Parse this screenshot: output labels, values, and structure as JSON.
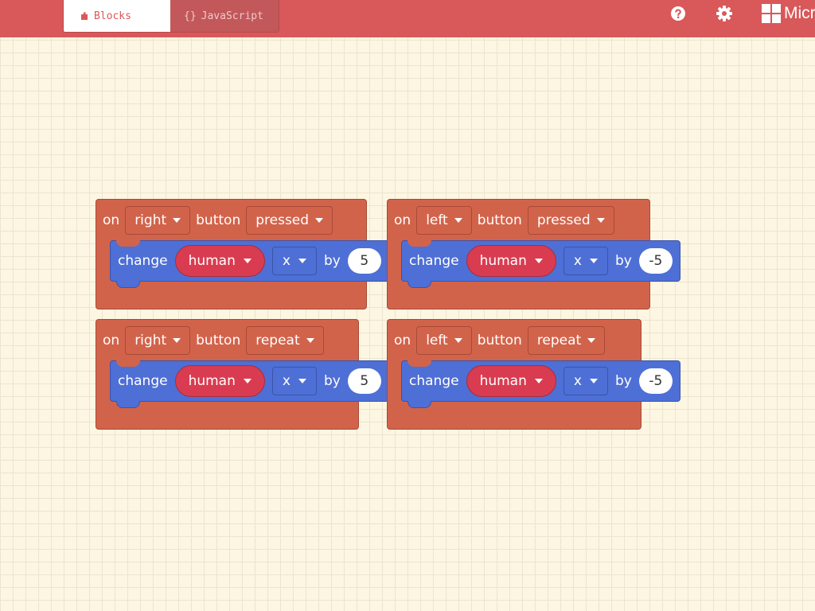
{
  "header": {
    "tabs": [
      {
        "label": "Blocks",
        "icon": "puzzle-icon"
      },
      {
        "label": "JavaScript",
        "icon": "braces-icon",
        "icon_text": "{}"
      }
    ],
    "brand_text": "Micr"
  },
  "colors": {
    "header": "#d9585a",
    "event_block": "#d2634b",
    "statement_block": "#4e6fd5",
    "variable": "#d93c50",
    "workspace": "#fcf6e2"
  },
  "blocks": [
    {
      "on": "on",
      "button_name": "right",
      "button_word": "button",
      "event": "pressed",
      "action": "change",
      "variable": "human",
      "property": "x",
      "by": "by",
      "value": "5"
    },
    {
      "on": "on",
      "button_name": "left",
      "button_word": "button",
      "event": "pressed",
      "action": "change",
      "variable": "human",
      "property": "x",
      "by": "by",
      "value": "-5"
    },
    {
      "on": "on",
      "button_name": "right",
      "button_word": "button",
      "event": "repeat",
      "action": "change",
      "variable": "human",
      "property": "x",
      "by": "by",
      "value": "5"
    },
    {
      "on": "on",
      "button_name": "left",
      "button_word": "button",
      "event": "repeat",
      "action": "change",
      "variable": "human",
      "property": "x",
      "by": "by",
      "value": "-5"
    }
  ]
}
